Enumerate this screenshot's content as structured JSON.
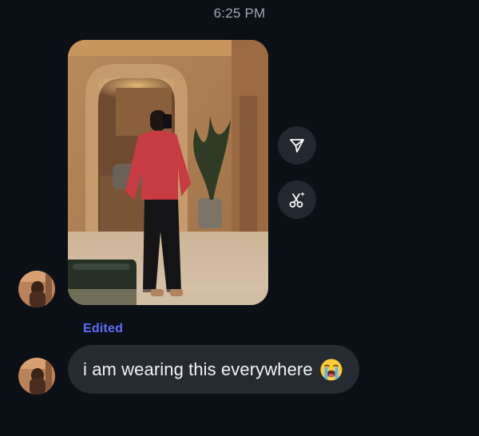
{
  "status": {
    "timestamp": "6:25 PM"
  },
  "thread": {
    "edited_label": "Edited",
    "message_text": "i am wearing this everywhere",
    "message_emoji": "loudly-crying-face"
  },
  "actions": {
    "share_icon": "send-icon",
    "remix_icon": "scissors-sparkle-icon"
  },
  "colors": {
    "background": "#0b0f16",
    "bubble": "#262a31",
    "action_button": "#232830",
    "edited_accent": "#5c6ef8",
    "timestamp": "#a2a9b3"
  }
}
